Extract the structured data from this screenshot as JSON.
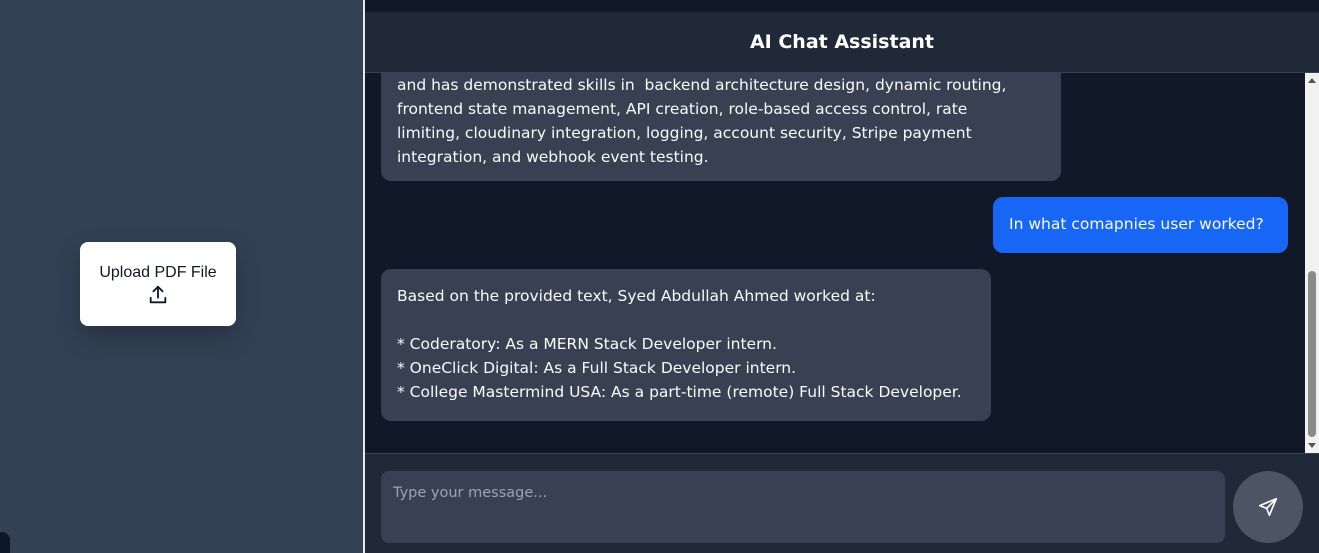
{
  "sidebar": {
    "upload_label": "Upload PDF File",
    "upload_icon": "upload-icon"
  },
  "header": {
    "title": "AI Chat Assistant"
  },
  "messages": [
    {
      "role": "assistant",
      "text": "and has demonstrated skills in  backend architecture design, dynamic routing,\nfrontend state management, API creation, role-based access control, rate\nlimiting, cloudinary integration, logging, account security, Stripe payment\nintegration, and webhook event testing."
    },
    {
      "role": "user",
      "text": "In what comapnies user worked?"
    },
    {
      "role": "assistant",
      "text": "Based on the provided text, Syed Abdullah Ahmed worked at:\n\n* Coderatory: As a MERN Stack Developer intern.\n* OneClick Digital: As a Full Stack Developer intern.\n* College Mastermind USA: As a part-time (remote) Full Stack Developer."
    }
  ],
  "composer": {
    "placeholder": "Type your message...",
    "value": "",
    "send_icon": "send-icon"
  },
  "colors": {
    "sidebar_bg": "#334155",
    "chat_bg": "#111827",
    "header_bg": "#1f2937",
    "assistant_bubble": "#374151",
    "user_bubble": "#1766f5",
    "send_button": "#4b5563"
  }
}
